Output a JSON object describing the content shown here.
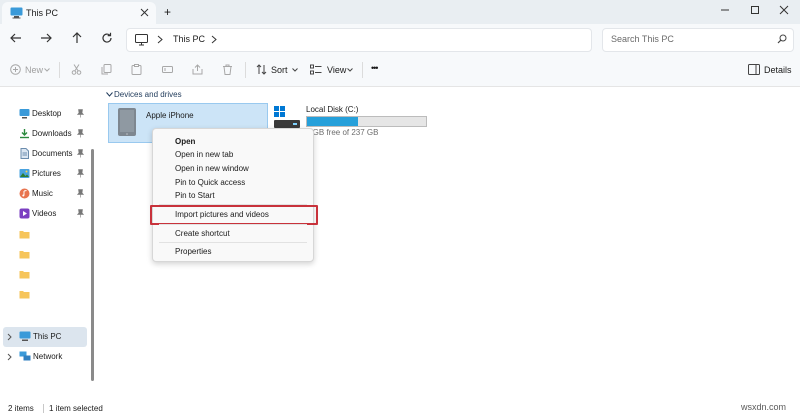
{
  "window": {
    "tab_title": "This PC",
    "new_tab_symbol": "+"
  },
  "address_bar": {
    "path_label": "This PC",
    "search_placeholder": "Search This PC"
  },
  "command_bar": {
    "new_label": "New",
    "sort_label": "Sort",
    "view_label": "View",
    "more_symbol": "•••",
    "details_label": "Details"
  },
  "sidebar": {
    "pinned": [
      {
        "label": "Desktop",
        "icon": "desktop-icon"
      },
      {
        "label": "Downloads",
        "icon": "downloads-icon"
      },
      {
        "label": "Documents",
        "icon": "documents-icon"
      },
      {
        "label": "Pictures",
        "icon": "pictures-icon"
      },
      {
        "label": "Music",
        "icon": "music-icon"
      },
      {
        "label": "Videos",
        "icon": "videos-icon"
      }
    ],
    "this_pc_label": "This PC",
    "network_label": "Network"
  },
  "content": {
    "group_title": "Devices and drives",
    "iphone_label": "Apple iPhone",
    "disk_label": "Local Disk (C:)",
    "disk_free_text": "0 GB free of 237 GB",
    "disk_used_fraction": 0.43
  },
  "context_menu": {
    "items": [
      "Open",
      "Open in new tab",
      "Open in new window",
      "Pin to Quick access",
      "Pin to Start",
      "Import pictures and videos",
      "Create shortcut",
      "Properties"
    ],
    "highlight_color": "#c8323b"
  },
  "status": {
    "items_count": "2 items",
    "selected_count": "1 item selected"
  },
  "watermark": "wsxdn.com",
  "colors": {
    "accent": "#26a0da",
    "selection": "#cce4f7",
    "folder": "#f6c55c"
  }
}
